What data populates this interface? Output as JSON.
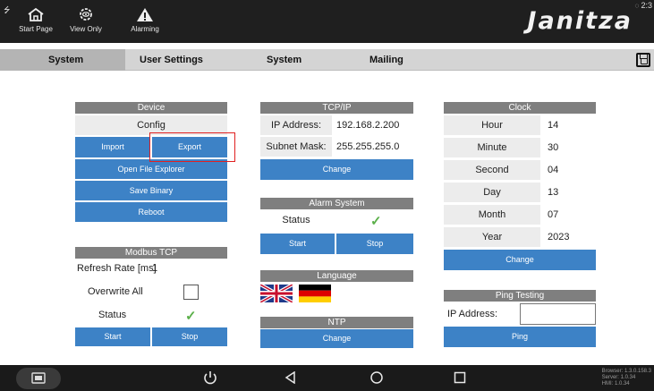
{
  "topbar": {
    "nav": [
      {
        "label": "Start Page",
        "icon": "home-icon"
      },
      {
        "label": "View Only",
        "icon": "eye-gear-icon"
      },
      {
        "label": "Alarming",
        "icon": "warning-icon"
      }
    ],
    "logo": "Janitza",
    "clock": "2:3"
  },
  "tabs": [
    {
      "label": "System",
      "active": true
    },
    {
      "label": "User Settings",
      "active": false
    },
    {
      "label": "System",
      "active": false
    },
    {
      "label": "Mailing",
      "active": false
    }
  ],
  "device": {
    "header": "Device",
    "config": "Config",
    "import": "Import",
    "export": "Export",
    "open_file_explorer": "Open File Explorer",
    "save_binary": "Save Binary",
    "reboot": "Reboot"
  },
  "modbus": {
    "header": "Modbus TCP",
    "refresh_label": "Refresh Rate [ms]",
    "refresh_value": "1",
    "overwrite_label": "Overwrite All",
    "status_label": "Status",
    "status_check": "✓",
    "start": "Start",
    "stop": "Stop"
  },
  "tcpip": {
    "header": "TCP/IP",
    "ip_label": "IP Address:",
    "ip_value": "192.168.2.200",
    "subnet_label": "Subnet Mask:",
    "subnet_value": "255.255.255.0",
    "change": "Change"
  },
  "alarm": {
    "header": "Alarm System",
    "status_label": "Status",
    "status_check": "✓",
    "start": "Start",
    "stop": "Stop"
  },
  "language": {
    "header": "Language",
    "flags": [
      "uk-flag",
      "germany-flag"
    ]
  },
  "ntp": {
    "header": "NTP",
    "change": "Change"
  },
  "clock_panel": {
    "header": "Clock",
    "rows": [
      {
        "label": "Hour",
        "value": "14"
      },
      {
        "label": "Minute",
        "value": "30"
      },
      {
        "label": "Second",
        "value": "04"
      },
      {
        "label": "Day",
        "value": "13"
      },
      {
        "label": "Month",
        "value": "07"
      },
      {
        "label": "Year",
        "value": "2023"
      }
    ],
    "change": "Change"
  },
  "ping": {
    "header": "Ping Testing",
    "ip_label": "IP Address:",
    "ip_value": "",
    "ping": "Ping"
  },
  "version": {
    "lines": [
      "Browser: 1.3.0.158.3",
      "Server: 1.0.34",
      "HMI: 1.0.34"
    ]
  },
  "colors": {
    "accent_button": "#3d82c6",
    "header_grey": "#7f7f7f",
    "check_green": "#5bb04a",
    "highlight_red": "#e02020"
  }
}
